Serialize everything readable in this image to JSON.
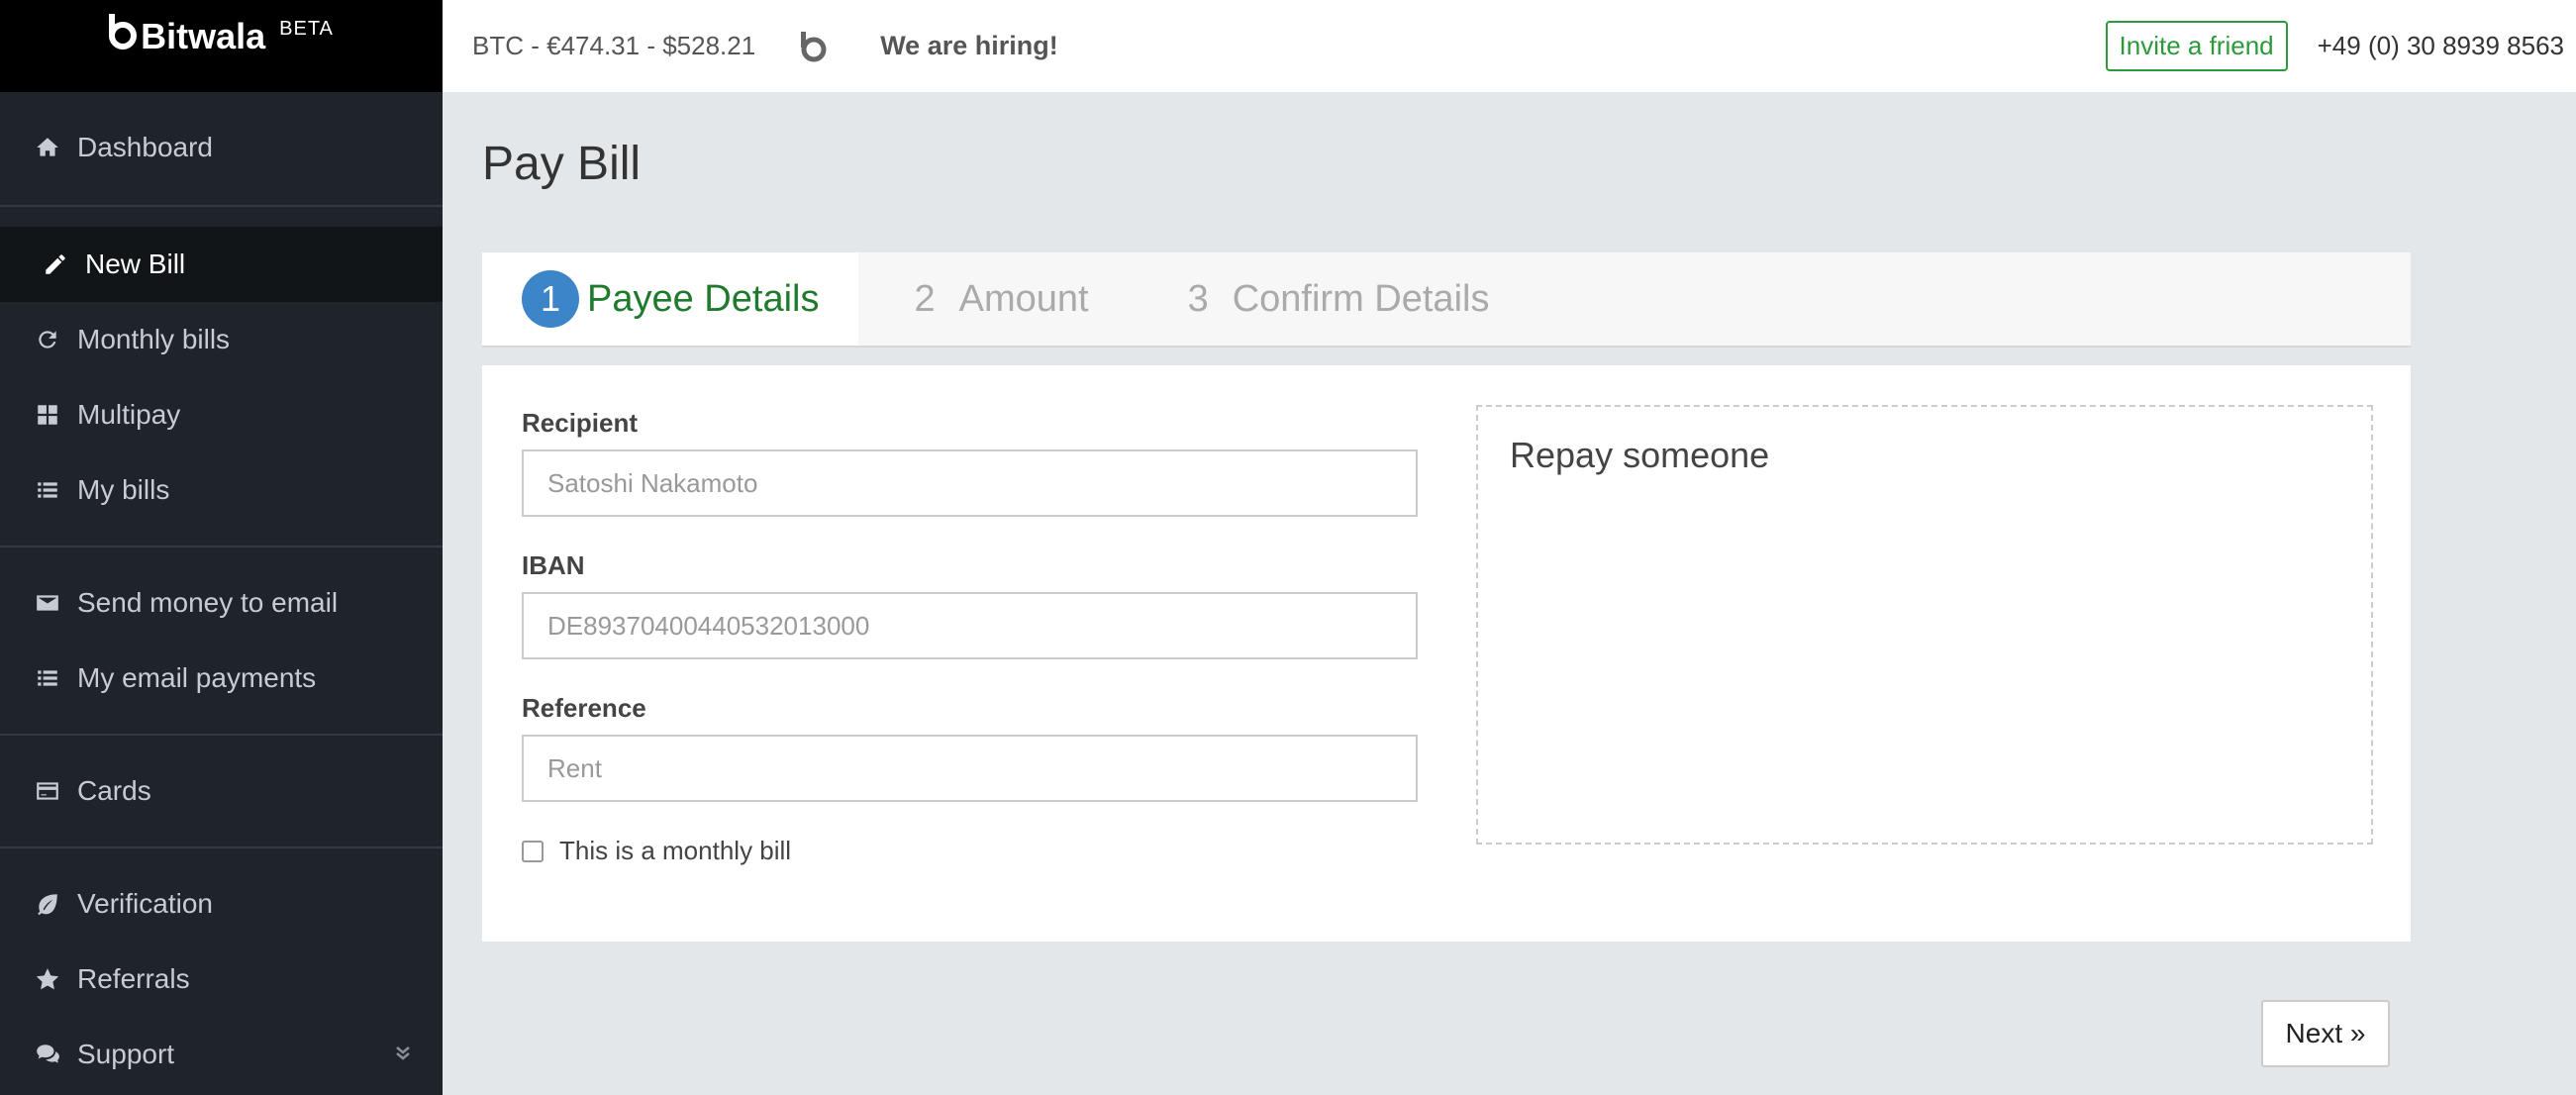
{
  "brand": {
    "name": "Bitwala",
    "badge": "BETA"
  },
  "sidebar": {
    "groups": [
      [
        {
          "label": "Dashboard",
          "icon": "home-icon"
        }
      ],
      [
        {
          "label": "New Bill",
          "icon": "pencil-icon",
          "active": true
        },
        {
          "label": "Monthly bills",
          "icon": "refresh-icon"
        },
        {
          "label": "Multipay",
          "icon": "grid-icon"
        },
        {
          "label": "My bills",
          "icon": "list-icon"
        }
      ],
      [
        {
          "label": "Send money to email",
          "icon": "envelope-icon"
        },
        {
          "label": "My email payments",
          "icon": "list-icon"
        }
      ],
      [
        {
          "label": "Cards",
          "icon": "credit-card-icon"
        }
      ],
      [
        {
          "label": "Verification",
          "icon": "leaf-icon"
        },
        {
          "label": "Referrals",
          "icon": "star-icon"
        },
        {
          "label": "Support",
          "icon": "chat-icon"
        }
      ]
    ]
  },
  "topbar": {
    "ticker": "BTC - €474.31 - $528.21",
    "hiring": "We are hiring!",
    "invite": "Invite a friend",
    "phone": "+49 (0) 30 8939 8563"
  },
  "page": {
    "title": "Pay Bill"
  },
  "steps": [
    {
      "num": "1",
      "label": "Payee Details",
      "active": true
    },
    {
      "num": "2",
      "label": "Amount"
    },
    {
      "num": "3",
      "label": "Confirm Details"
    }
  ],
  "form": {
    "recipient_label": "Recipient",
    "recipient_placeholder": "Satoshi Nakamoto",
    "iban_label": "IBAN",
    "iban_placeholder": "DE89370400440532013000",
    "reference_label": "Reference",
    "reference_placeholder": "Rent",
    "monthly_label": "This is a monthly bill",
    "repay_title": "Repay someone"
  },
  "actions": {
    "next": "Next »"
  },
  "colors": {
    "accent_green": "#2a9a3a",
    "step_blue": "#3b85c8",
    "sidebar_bg": "#1f232a"
  }
}
